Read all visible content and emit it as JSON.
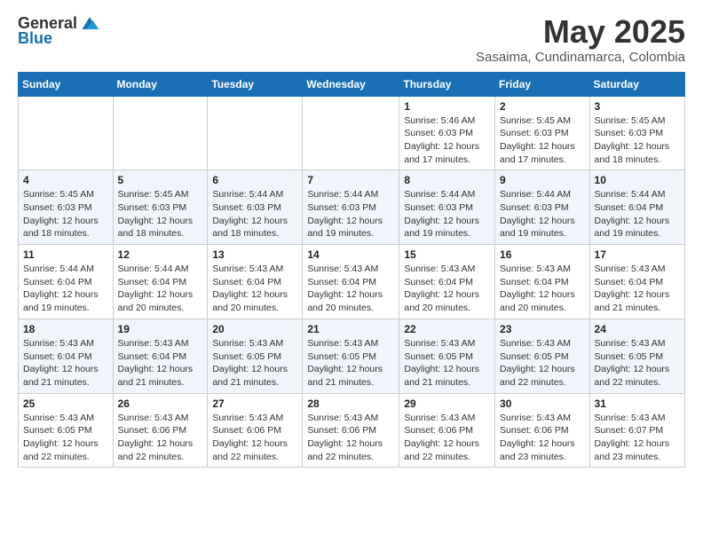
{
  "header": {
    "logo_general": "General",
    "logo_blue": "Blue",
    "month_title": "May 2025",
    "subtitle": "Sasaima, Cundinamarca, Colombia"
  },
  "weekdays": [
    "Sunday",
    "Monday",
    "Tuesday",
    "Wednesday",
    "Thursday",
    "Friday",
    "Saturday"
  ],
  "weeks": [
    [
      {
        "day": "",
        "info": ""
      },
      {
        "day": "",
        "info": ""
      },
      {
        "day": "",
        "info": ""
      },
      {
        "day": "",
        "info": ""
      },
      {
        "day": "1",
        "info": "Sunrise: 5:46 AM\nSunset: 6:03 PM\nDaylight: 12 hours\nand 17 minutes."
      },
      {
        "day": "2",
        "info": "Sunrise: 5:45 AM\nSunset: 6:03 PM\nDaylight: 12 hours\nand 17 minutes."
      },
      {
        "day": "3",
        "info": "Sunrise: 5:45 AM\nSunset: 6:03 PM\nDaylight: 12 hours\nand 18 minutes."
      }
    ],
    [
      {
        "day": "4",
        "info": "Sunrise: 5:45 AM\nSunset: 6:03 PM\nDaylight: 12 hours\nand 18 minutes."
      },
      {
        "day": "5",
        "info": "Sunrise: 5:45 AM\nSunset: 6:03 PM\nDaylight: 12 hours\nand 18 minutes."
      },
      {
        "day": "6",
        "info": "Sunrise: 5:44 AM\nSunset: 6:03 PM\nDaylight: 12 hours\nand 18 minutes."
      },
      {
        "day": "7",
        "info": "Sunrise: 5:44 AM\nSunset: 6:03 PM\nDaylight: 12 hours\nand 19 minutes."
      },
      {
        "day": "8",
        "info": "Sunrise: 5:44 AM\nSunset: 6:03 PM\nDaylight: 12 hours\nand 19 minutes."
      },
      {
        "day": "9",
        "info": "Sunrise: 5:44 AM\nSunset: 6:03 PM\nDaylight: 12 hours\nand 19 minutes."
      },
      {
        "day": "10",
        "info": "Sunrise: 5:44 AM\nSunset: 6:04 PM\nDaylight: 12 hours\nand 19 minutes."
      }
    ],
    [
      {
        "day": "11",
        "info": "Sunrise: 5:44 AM\nSunset: 6:04 PM\nDaylight: 12 hours\nand 19 minutes."
      },
      {
        "day": "12",
        "info": "Sunrise: 5:44 AM\nSunset: 6:04 PM\nDaylight: 12 hours\nand 20 minutes."
      },
      {
        "day": "13",
        "info": "Sunrise: 5:43 AM\nSunset: 6:04 PM\nDaylight: 12 hours\nand 20 minutes."
      },
      {
        "day": "14",
        "info": "Sunrise: 5:43 AM\nSunset: 6:04 PM\nDaylight: 12 hours\nand 20 minutes."
      },
      {
        "day": "15",
        "info": "Sunrise: 5:43 AM\nSunset: 6:04 PM\nDaylight: 12 hours\nand 20 minutes."
      },
      {
        "day": "16",
        "info": "Sunrise: 5:43 AM\nSunset: 6:04 PM\nDaylight: 12 hours\nand 20 minutes."
      },
      {
        "day": "17",
        "info": "Sunrise: 5:43 AM\nSunset: 6:04 PM\nDaylight: 12 hours\nand 21 minutes."
      }
    ],
    [
      {
        "day": "18",
        "info": "Sunrise: 5:43 AM\nSunset: 6:04 PM\nDaylight: 12 hours\nand 21 minutes."
      },
      {
        "day": "19",
        "info": "Sunrise: 5:43 AM\nSunset: 6:04 PM\nDaylight: 12 hours\nand 21 minutes."
      },
      {
        "day": "20",
        "info": "Sunrise: 5:43 AM\nSunset: 6:05 PM\nDaylight: 12 hours\nand 21 minutes."
      },
      {
        "day": "21",
        "info": "Sunrise: 5:43 AM\nSunset: 6:05 PM\nDaylight: 12 hours\nand 21 minutes."
      },
      {
        "day": "22",
        "info": "Sunrise: 5:43 AM\nSunset: 6:05 PM\nDaylight: 12 hours\nand 21 minutes."
      },
      {
        "day": "23",
        "info": "Sunrise: 5:43 AM\nSunset: 6:05 PM\nDaylight: 12 hours\nand 22 minutes."
      },
      {
        "day": "24",
        "info": "Sunrise: 5:43 AM\nSunset: 6:05 PM\nDaylight: 12 hours\nand 22 minutes."
      }
    ],
    [
      {
        "day": "25",
        "info": "Sunrise: 5:43 AM\nSunset: 6:05 PM\nDaylight: 12 hours\nand 22 minutes."
      },
      {
        "day": "26",
        "info": "Sunrise: 5:43 AM\nSunset: 6:06 PM\nDaylight: 12 hours\nand 22 minutes."
      },
      {
        "day": "27",
        "info": "Sunrise: 5:43 AM\nSunset: 6:06 PM\nDaylight: 12 hours\nand 22 minutes."
      },
      {
        "day": "28",
        "info": "Sunrise: 5:43 AM\nSunset: 6:06 PM\nDaylight: 12 hours\nand 22 minutes."
      },
      {
        "day": "29",
        "info": "Sunrise: 5:43 AM\nSunset: 6:06 PM\nDaylight: 12 hours\nand 22 minutes."
      },
      {
        "day": "30",
        "info": "Sunrise: 5:43 AM\nSunset: 6:06 PM\nDaylight: 12 hours\nand 23 minutes."
      },
      {
        "day": "31",
        "info": "Sunrise: 5:43 AM\nSunset: 6:07 PM\nDaylight: 12 hours\nand 23 minutes."
      }
    ]
  ]
}
